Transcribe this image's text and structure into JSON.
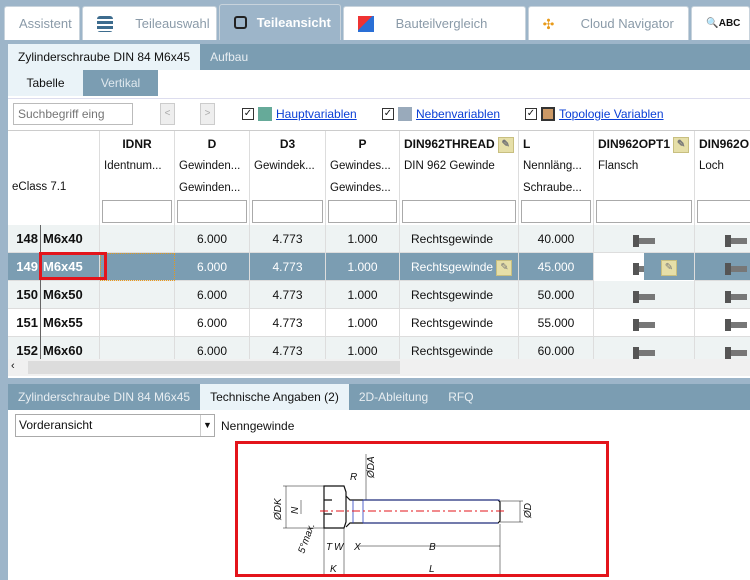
{
  "top_tabs": [
    {
      "label": "Assistent",
      "icon": ""
    },
    {
      "label": "Teileauswahl",
      "icon": "stack-icon"
    },
    {
      "label": "Teileansicht",
      "icon": "cubes-icon",
      "active": true
    },
    {
      "label": "Bauteilvergleich",
      "icon": "compare-icon"
    },
    {
      "label": "Cloud Navigator",
      "icon": "network-icon"
    },
    {
      "label": "",
      "icon": "search-abc-icon"
    }
  ],
  "part_tabs": {
    "part": "Zylinderschraube DIN 84 M6x45",
    "structure": "Aufbau"
  },
  "view_tabs": {
    "table": "Tabelle",
    "vertical": "Vertikal"
  },
  "toolbar": {
    "search_placeholder": "Suchbegriff eing",
    "prev": "<",
    "next": ">",
    "main_vars": "Hauptvariablen",
    "sub_vars": "Nebenvariablen",
    "topo_vars": "Topologie Variablen"
  },
  "table": {
    "corner_label": "eClass 7.1",
    "columns": [
      {
        "name": "IDNR",
        "d1": "Identnum...",
        "d2": ""
      },
      {
        "name": "D",
        "d1": "Gewinden...",
        "d2": "Gewinden..."
      },
      {
        "name": "D3",
        "d1": "Gewindek...",
        "d2": ""
      },
      {
        "name": "P",
        "d1": "Gewindes...",
        "d2": "Gewindes..."
      },
      {
        "name": "DIN962THREAD",
        "d1": "DIN 962 Gewinde",
        "d2": ""
      },
      {
        "name": "L",
        "d1": "Nennläng...",
        "d2": "Schraube..."
      },
      {
        "name": "DIN962OPT1",
        "d1": "Flansch",
        "d2": ""
      },
      {
        "name": "DIN962O",
        "d1": "Loch",
        "d2": ""
      }
    ],
    "rows": [
      {
        "n": "148",
        "name": "M6x40",
        "d": "6.000",
        "d3": "4.773",
        "p": "1.000",
        "thread": "Rechtsgewinde",
        "l": "40.000"
      },
      {
        "n": "149",
        "name": "M6x45",
        "d": "6.000",
        "d3": "4.773",
        "p": "1.000",
        "thread": "Rechtsgewinde",
        "l": "45.000"
      },
      {
        "n": "150",
        "name": "M6x50",
        "d": "6.000",
        "d3": "4.773",
        "p": "1.000",
        "thread": "Rechtsgewinde",
        "l": "50.000"
      },
      {
        "n": "151",
        "name": "M6x55",
        "d": "6.000",
        "d3": "4.773",
        "p": "1.000",
        "thread": "Rechtsgewinde",
        "l": "55.000"
      },
      {
        "n": "152",
        "name": "M6x60",
        "d": "6.000",
        "d3": "4.773",
        "p": "1.000",
        "thread": "Rechtsgewinde",
        "l": "60.000"
      }
    ],
    "selected_row": "149"
  },
  "lower_tabs": [
    "Zylinderschraube DIN 84 M6x45",
    "Technische Angaben (2)",
    "2D-Ableitung",
    "RFQ"
  ],
  "view_select": "Vorderansicht",
  "view_label": "Nenngewinde",
  "drawing_labels": [
    "ØDA",
    "R",
    "ØDK",
    "N",
    "5°max.",
    "ØD",
    "T",
    "W",
    "X",
    "B",
    "K",
    "L"
  ],
  "colors": {
    "accent": "#7b9db2",
    "highlight": "#e3141b",
    "link": "#0a3fd6"
  }
}
